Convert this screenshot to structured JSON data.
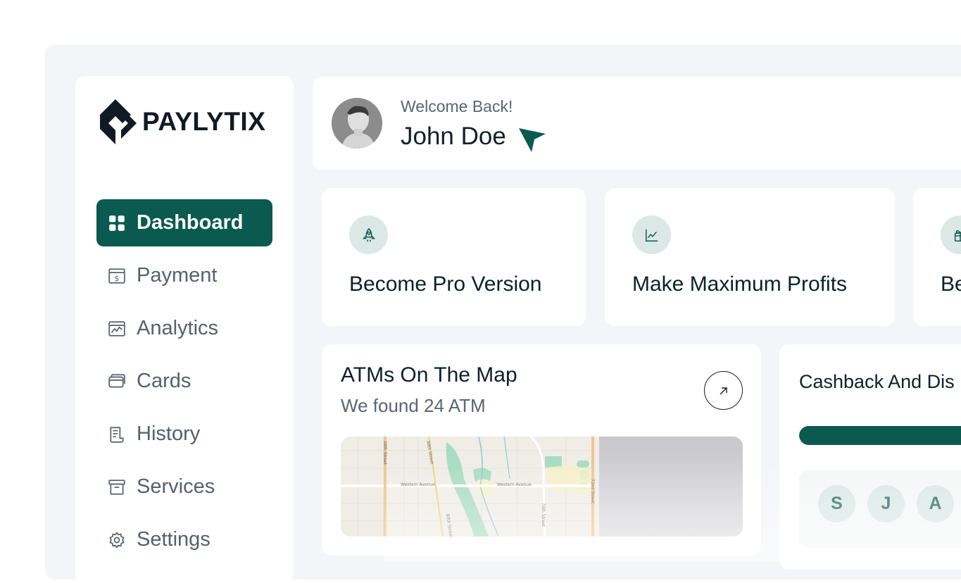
{
  "brand": {
    "name": "PAYLYTIX"
  },
  "sidebar": {
    "items": [
      {
        "label": "Dashboard",
        "icon": "grid-icon",
        "active": true
      },
      {
        "label": "Payment",
        "icon": "payment-icon"
      },
      {
        "label": "Analytics",
        "icon": "analytics-icon"
      },
      {
        "label": "Cards",
        "icon": "cards-icon"
      },
      {
        "label": "History",
        "icon": "history-icon"
      },
      {
        "label": "Services",
        "icon": "archive-icon"
      },
      {
        "label": "Settings",
        "icon": "gear-icon"
      }
    ]
  },
  "header": {
    "welcome": "Welcome Back!",
    "username": "John Doe"
  },
  "features": [
    {
      "title": "Become Pro Version",
      "icon": "rocket-icon"
    },
    {
      "title": "Make Maximum Profits",
      "icon": "chart-icon"
    },
    {
      "title": "Be",
      "icon": "gift-icon"
    }
  ],
  "atm": {
    "title": "ATMs On The Map",
    "subtitle": "We found 24 ATM",
    "map_labels": [
      "Western Avenue",
      "Western Avenue",
      "28th Street",
      "30th Street",
      "60th Street",
      "70th Street",
      "72nd Street"
    ]
  },
  "cashback": {
    "title": "Cashback And Dis",
    "progress": 1.0,
    "avatars": [
      "S",
      "J",
      "A"
    ]
  },
  "colors": {
    "accent": "#0b5a4f",
    "accent_soft": "#dbe8e6",
    "background": "#f4f5f9"
  }
}
